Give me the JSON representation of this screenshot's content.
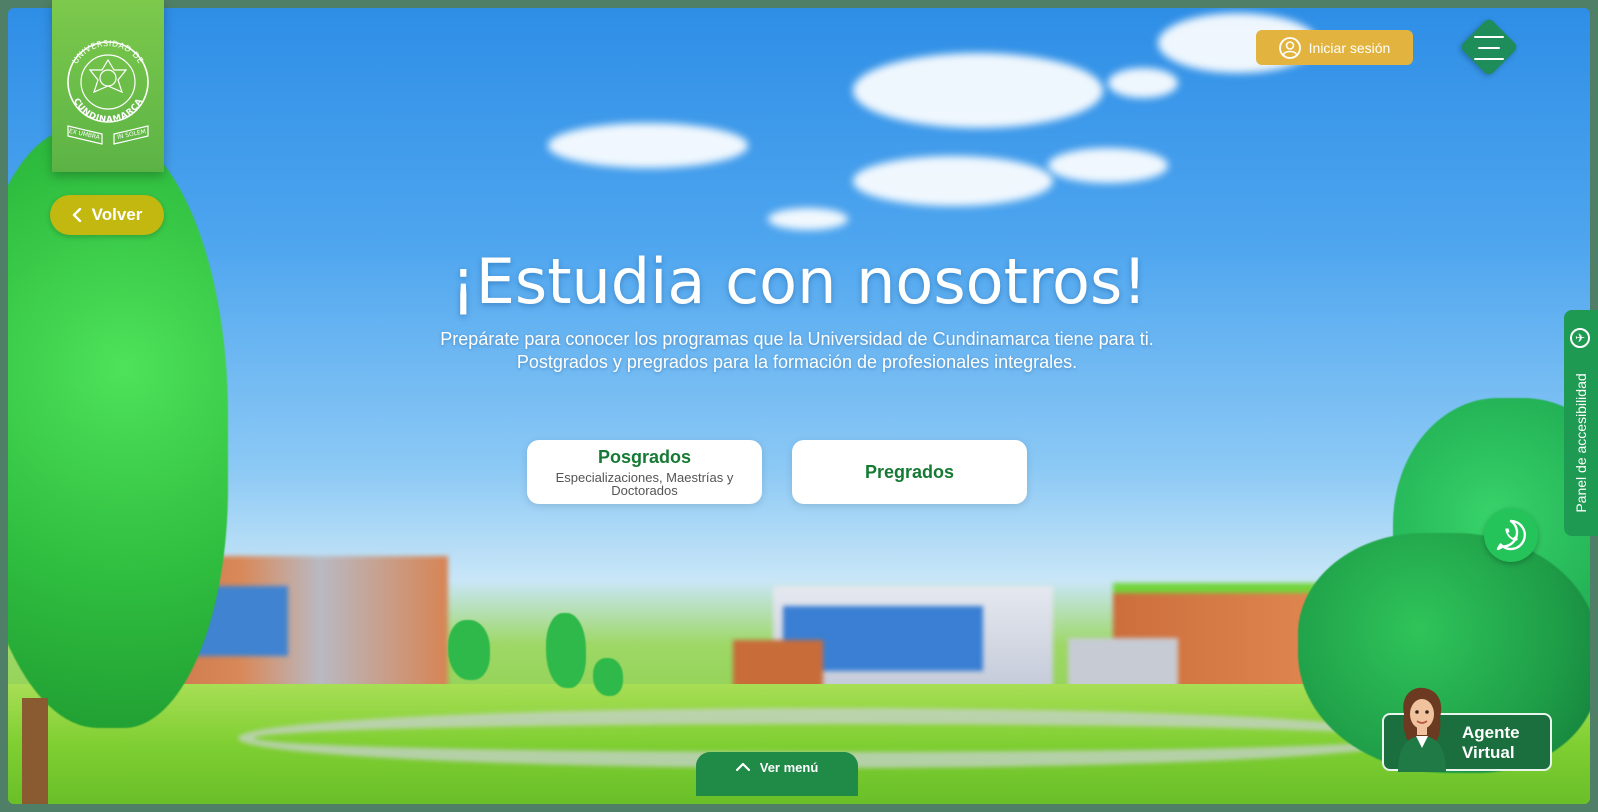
{
  "brand": {
    "logo_text_top": "UNIVERSIDAD DE",
    "logo_text_bottom": "CUNDINAMARCA",
    "motto_left": "EX UMBRA",
    "motto_right": "IN SOLEM"
  },
  "nav": {
    "back_label": "Volver",
    "login_label": "Iniciar sesión"
  },
  "hero": {
    "title": "¡Estudia con nosotros!",
    "subtitle": "Prepárate para conocer los programas que la Universidad de Cundinamarca tiene para ti. Postgrados y pregrados para la formación de profesionales integrales."
  },
  "programs": [
    {
      "label": "Posgrados",
      "detail": "Especializaciones, Maestrías y Doctorados"
    },
    {
      "label": "Pregrados",
      "detail": ""
    }
  ],
  "accessibility": {
    "label": "Panel de accesibilidad"
  },
  "footer": {
    "menu_label": "Ver menú"
  },
  "agent": {
    "line1": "Agente",
    "line2": "Virtual"
  },
  "colors": {
    "primary_green": "#208a47",
    "gold": "#e2b43f",
    "back_yellow": "#c3b80f",
    "whatsapp": "#25c45a"
  },
  "icons": [
    "user-icon",
    "hamburger-icon",
    "chevron-left-icon",
    "accessibility-icon",
    "whatsapp-icon",
    "chevron-up-icon"
  ]
}
